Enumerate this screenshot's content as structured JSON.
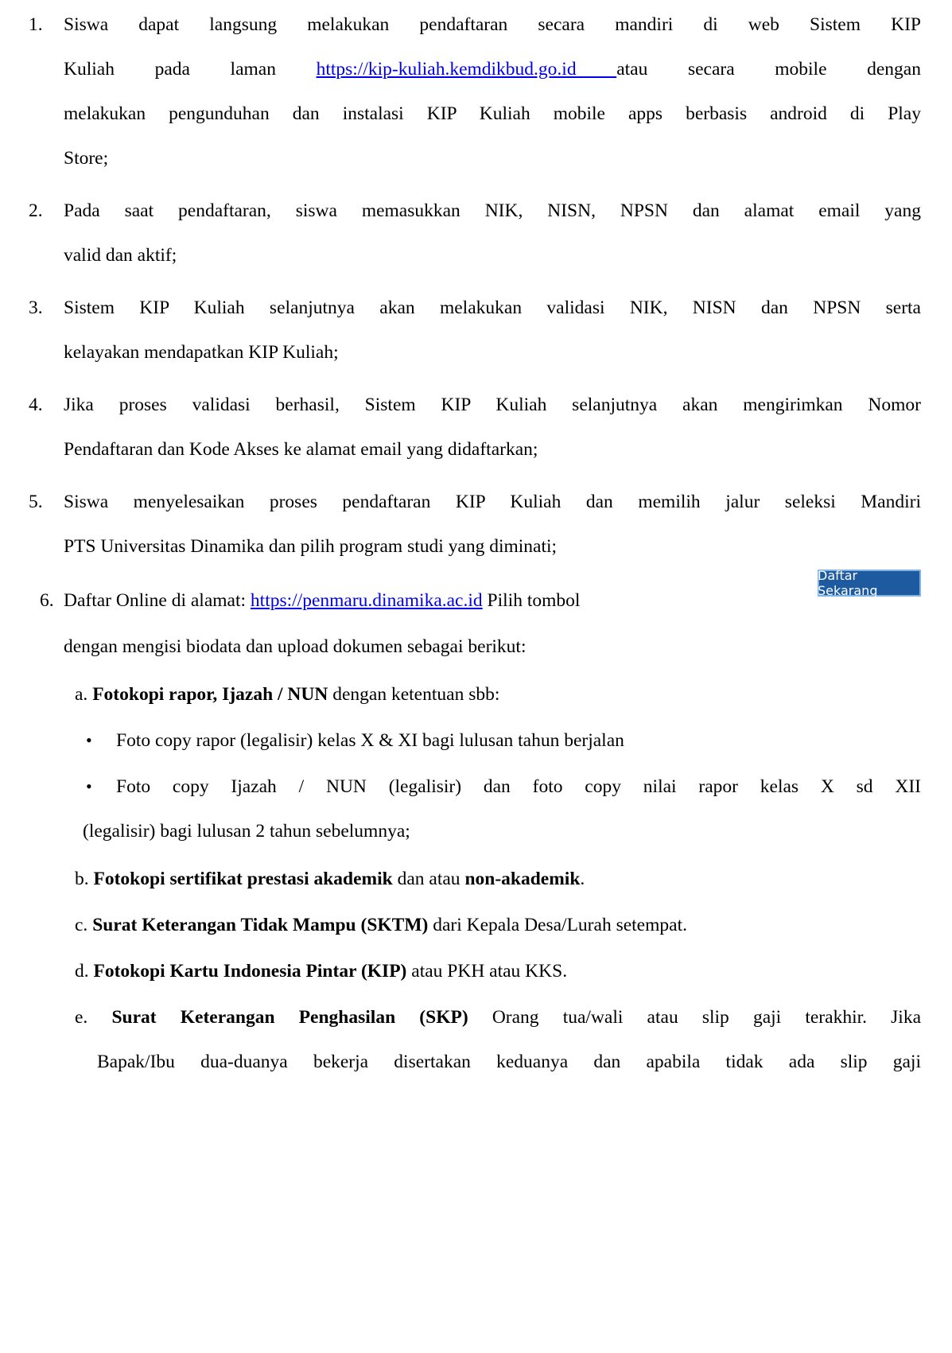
{
  "items": [
    {
      "num": "1.",
      "l1a": "Siswa dapat langsung melakukan pendaftaran secara mandiri di web Sistem KIP",
      "l2a": "Kuliah pada laman ",
      "l2link": "https://kip-kuliah.kemdikbud.go.id ",
      "l2b": "atau secara mobile dengan",
      "l3": "melakukan pengunduhan dan instalasi KIP Kuliah mobile apps berbasis android di Play",
      "l4": "Store;"
    },
    {
      "num": "2.",
      "l1": "Pada saat pendaftaran, siswa memasukkan NIK, NISN, NPSN dan alamat email yang",
      "l2": "valid dan aktif;"
    },
    {
      "num": "3.",
      "l1": "Sistem KIP Kuliah selanjutnya akan melakukan validasi NIK, NISN dan NPSN serta",
      "l2": "kelayakan mendapatkan KIP Kuliah;"
    },
    {
      "num": "4.",
      "l1": "Jika proses validasi berhasil, Sistem KIP Kuliah selanjutnya akan mengirimkan Nomor",
      "l2": "Pendaftaran dan Kode Akses ke alamat email yang didaftarkan;"
    },
    {
      "num": "5.",
      "l1": "Siswa menyelesaikan proses pendaftaran KIP Kuliah dan memilih jalur seleksi Mandiri",
      "l2": "PTS Universitas Dinamika dan pilih program studi yang diminati;"
    },
    {
      "num": "6.",
      "l1a": "Daftar Online di alamat: ",
      "l1link": "https://penmaru.dinamika.ac.id",
      "l1b": " Pilih tombol",
      "button": "Daftar Sekarang",
      "l2": "dengan mengisi biodata dan upload dokumen sebagai berikut:"
    }
  ],
  "sub": {
    "a": {
      "letter": "a.",
      "bold": "Fotokopi rapor, Ijazah / NUN",
      "rest": " dengan ketentuan sbb:",
      "bullet1": "Foto copy rapor (legalisir) kelas X & XI bagi lulusan tahun berjalan",
      "bullet2a": "Foto copy Ijazah / NUN (legalisir) dan foto copy nilai rapor kelas X sd XII",
      "bullet2b": "(legalisir)  bagi lulusan 2 tahun sebelumnya;"
    },
    "b": {
      "letter": "b.",
      "bold1": "Fotokopi sertifikat prestasi akademik",
      "mid": " dan atau ",
      "bold2": "non-akademik",
      "end": "."
    },
    "c": {
      "letter": "c.",
      "bold": "Surat Keterangan Tidak Mampu (SKTM)",
      "rest": " dari Kepala Desa/Lurah setempat."
    },
    "d": {
      "letter": "d.",
      "bold": "Fotokopi Kartu Indonesia Pintar (KIP)",
      "rest": " atau PKH atau KKS."
    },
    "e": {
      "letter": "e.",
      "bold": "Surat Keterangan Penghasilan (SKP)",
      "rest": " Orang tua/wali atau slip gaji terakhir. Jika",
      "line2": "Bapak/Ibu dua-duanya bekerja disertakan keduanya dan apabila tidak ada slip gaji"
    }
  }
}
